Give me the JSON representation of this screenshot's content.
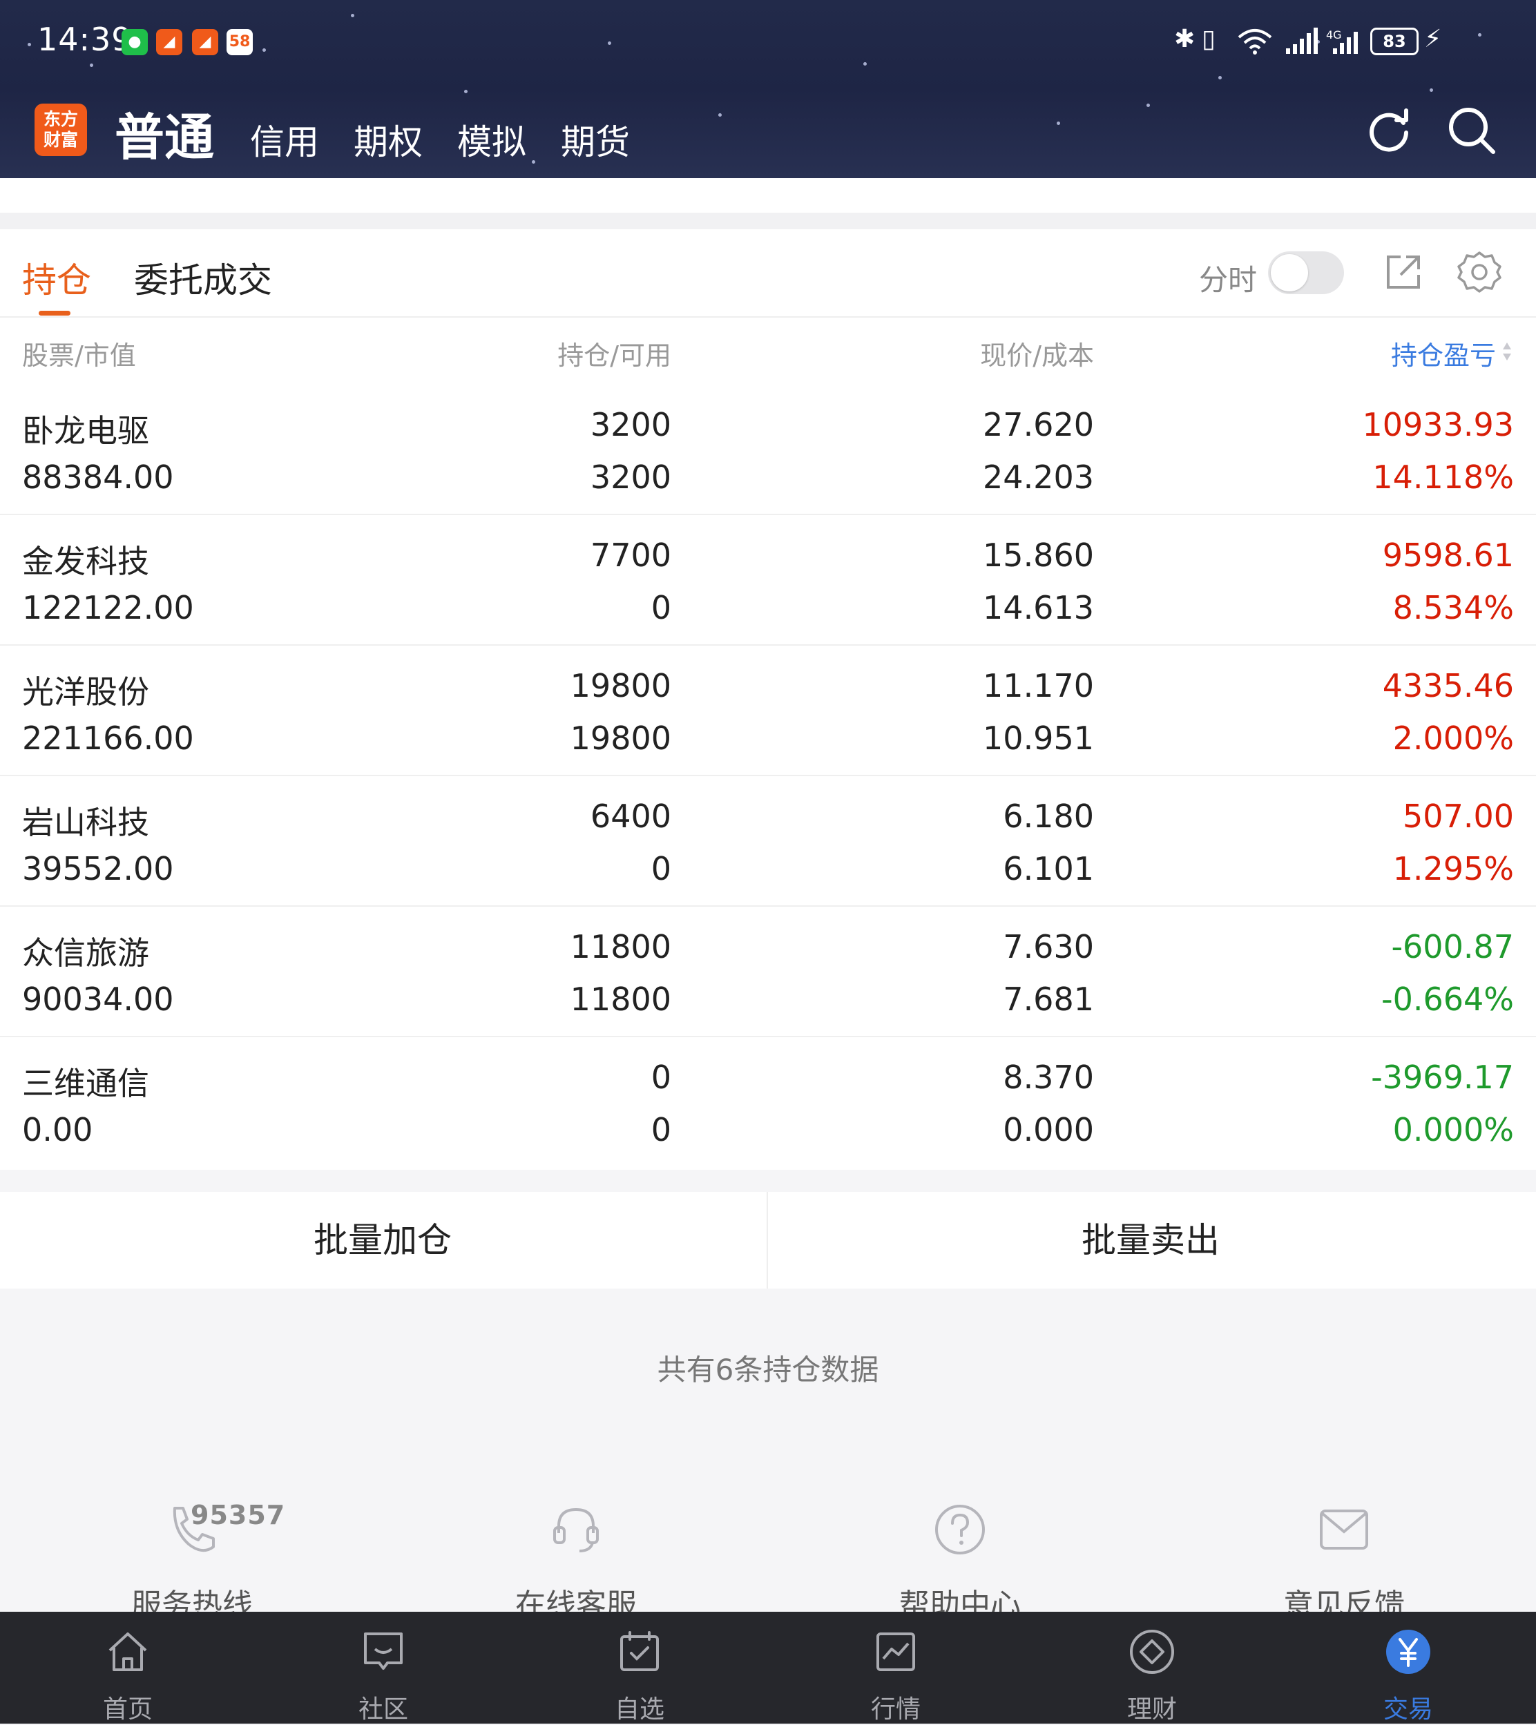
{
  "status_bar": {
    "time": "14:39",
    "notifications": [
      "wechat-icon",
      "app-icon-orange",
      "app-icon-orange",
      "app-58-icon"
    ],
    "battery": "83"
  },
  "header": {
    "logo_text": "东方财富",
    "main_tab": "普通",
    "tabs": [
      "信用",
      "期权",
      "模拟",
      "期货"
    ]
  },
  "content": {
    "tabs": [
      "持仓",
      "委托成交"
    ],
    "fenshi_label": "分时",
    "fenshi_on": false,
    "columns": [
      "股票/市值",
      "持仓/可用",
      "现价/成本",
      "持仓盈亏"
    ],
    "positions": [
      {
        "name": "卧龙电驱",
        "value": "88384.00",
        "hold": "3200",
        "avail": "3200",
        "price": "27.620",
        "cost": "24.203",
        "pl": "10933.93",
        "pl_pct": "14.118%",
        "dir": "up"
      },
      {
        "name": "金发科技",
        "value": "122122.00",
        "hold": "7700",
        "avail": "0",
        "price": "15.860",
        "cost": "14.613",
        "pl": "9598.61",
        "pl_pct": "8.534%",
        "dir": "up"
      },
      {
        "name": "光洋股份",
        "value": "221166.00",
        "hold": "19800",
        "avail": "19800",
        "price": "11.170",
        "cost": "10.951",
        "pl": "4335.46",
        "pl_pct": "2.000%",
        "dir": "up"
      },
      {
        "name": "岩山科技",
        "value": "39552.00",
        "hold": "6400",
        "avail": "0",
        "price": "6.180",
        "cost": "6.101",
        "pl": "507.00",
        "pl_pct": "1.295%",
        "dir": "up"
      },
      {
        "name": "众信旅游",
        "value": "90034.00",
        "hold": "11800",
        "avail": "11800",
        "price": "7.630",
        "cost": "7.681",
        "pl": "-600.87",
        "pl_pct": "-0.664%",
        "dir": "down"
      },
      {
        "name": "三维通信",
        "value": "0.00",
        "hold": "0",
        "avail": "0",
        "price": "8.370",
        "cost": "0.000",
        "pl": "-3969.17",
        "pl_pct": "0.000%",
        "dir": "down"
      }
    ],
    "batch_add": "批量加仓",
    "batch_sell": "批量卖出",
    "summary": "共有6条持仓数据"
  },
  "services": {
    "hotline_number": "95357",
    "items": [
      "服务热线",
      "在线客服",
      "帮助中心",
      "意见反馈"
    ]
  },
  "bottom_nav": {
    "items": [
      "首页",
      "社区",
      "自选",
      "行情",
      "理财",
      "交易"
    ],
    "active_index": 5
  },
  "colors": {
    "accent": "#e8601c",
    "up": "#d81e06",
    "down": "#1e9a2c",
    "blue": "#3a7be0",
    "header_bg": "#222a4a"
  }
}
